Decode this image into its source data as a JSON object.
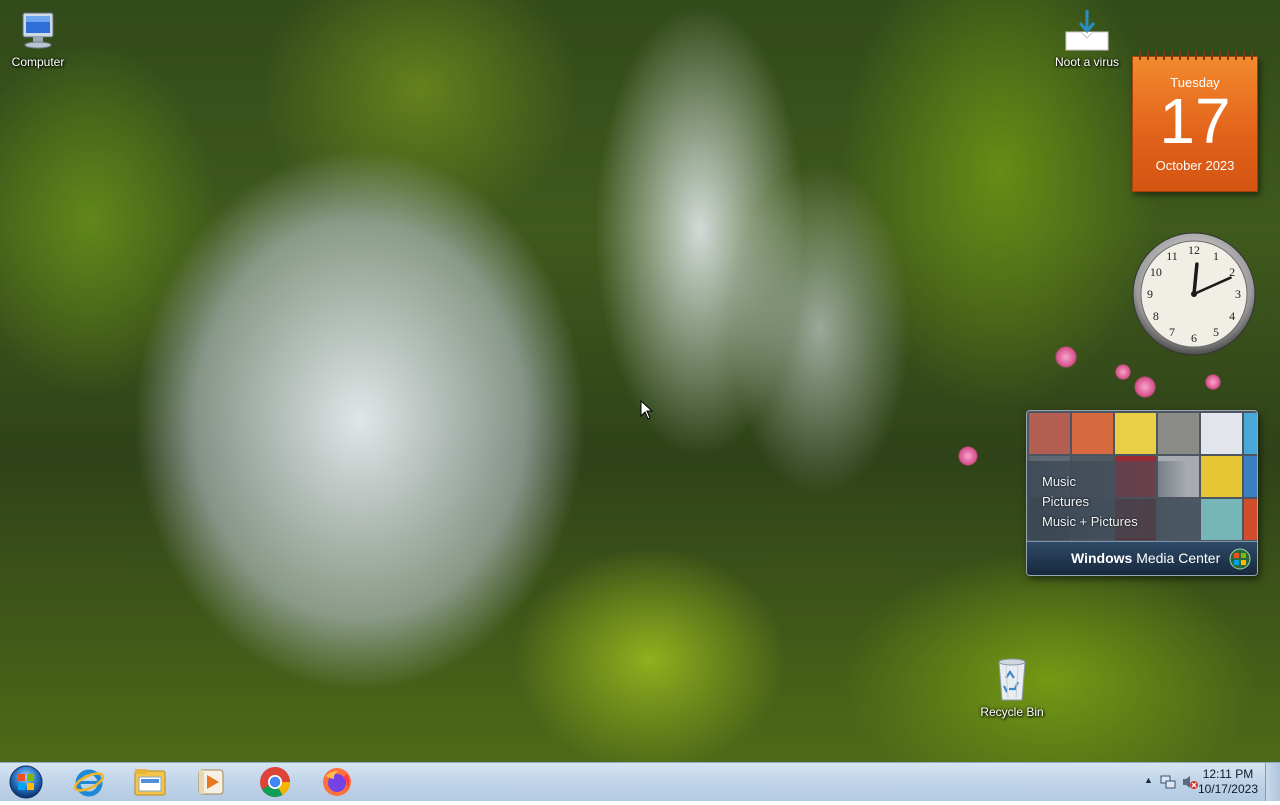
{
  "desktop": {
    "icons": [
      {
        "label": "Computer"
      },
      {
        "label": "Noot a virus"
      },
      {
        "label": "Recycle Bin"
      }
    ]
  },
  "calendar_gadget": {
    "weekday": "Tuesday",
    "day": "17",
    "month_year": "October 2023",
    "accent_color": "#e2611a"
  },
  "clock_gadget": {
    "time": "12:11",
    "numerals": [
      "12",
      "1",
      "2",
      "3",
      "4",
      "5",
      "6",
      "7",
      "8",
      "9",
      "10",
      "11"
    ]
  },
  "media_center_gadget": {
    "menu": [
      "Music",
      "Pictures",
      "Music + Pictures"
    ],
    "title_bold": "Windows",
    "title_rest": " Media Center"
  },
  "taskbar": {
    "start_icon": "windows-start-orb",
    "apps": [
      {
        "name": "internet-explorer-icon"
      },
      {
        "name": "file-explorer-icon"
      },
      {
        "name": "media-player-icon"
      },
      {
        "name": "chrome-icon"
      },
      {
        "name": "firefox-icon"
      }
    ],
    "tray": {
      "show_hidden": "▲",
      "time": "12:11 PM",
      "date": "10/17/2023"
    }
  }
}
